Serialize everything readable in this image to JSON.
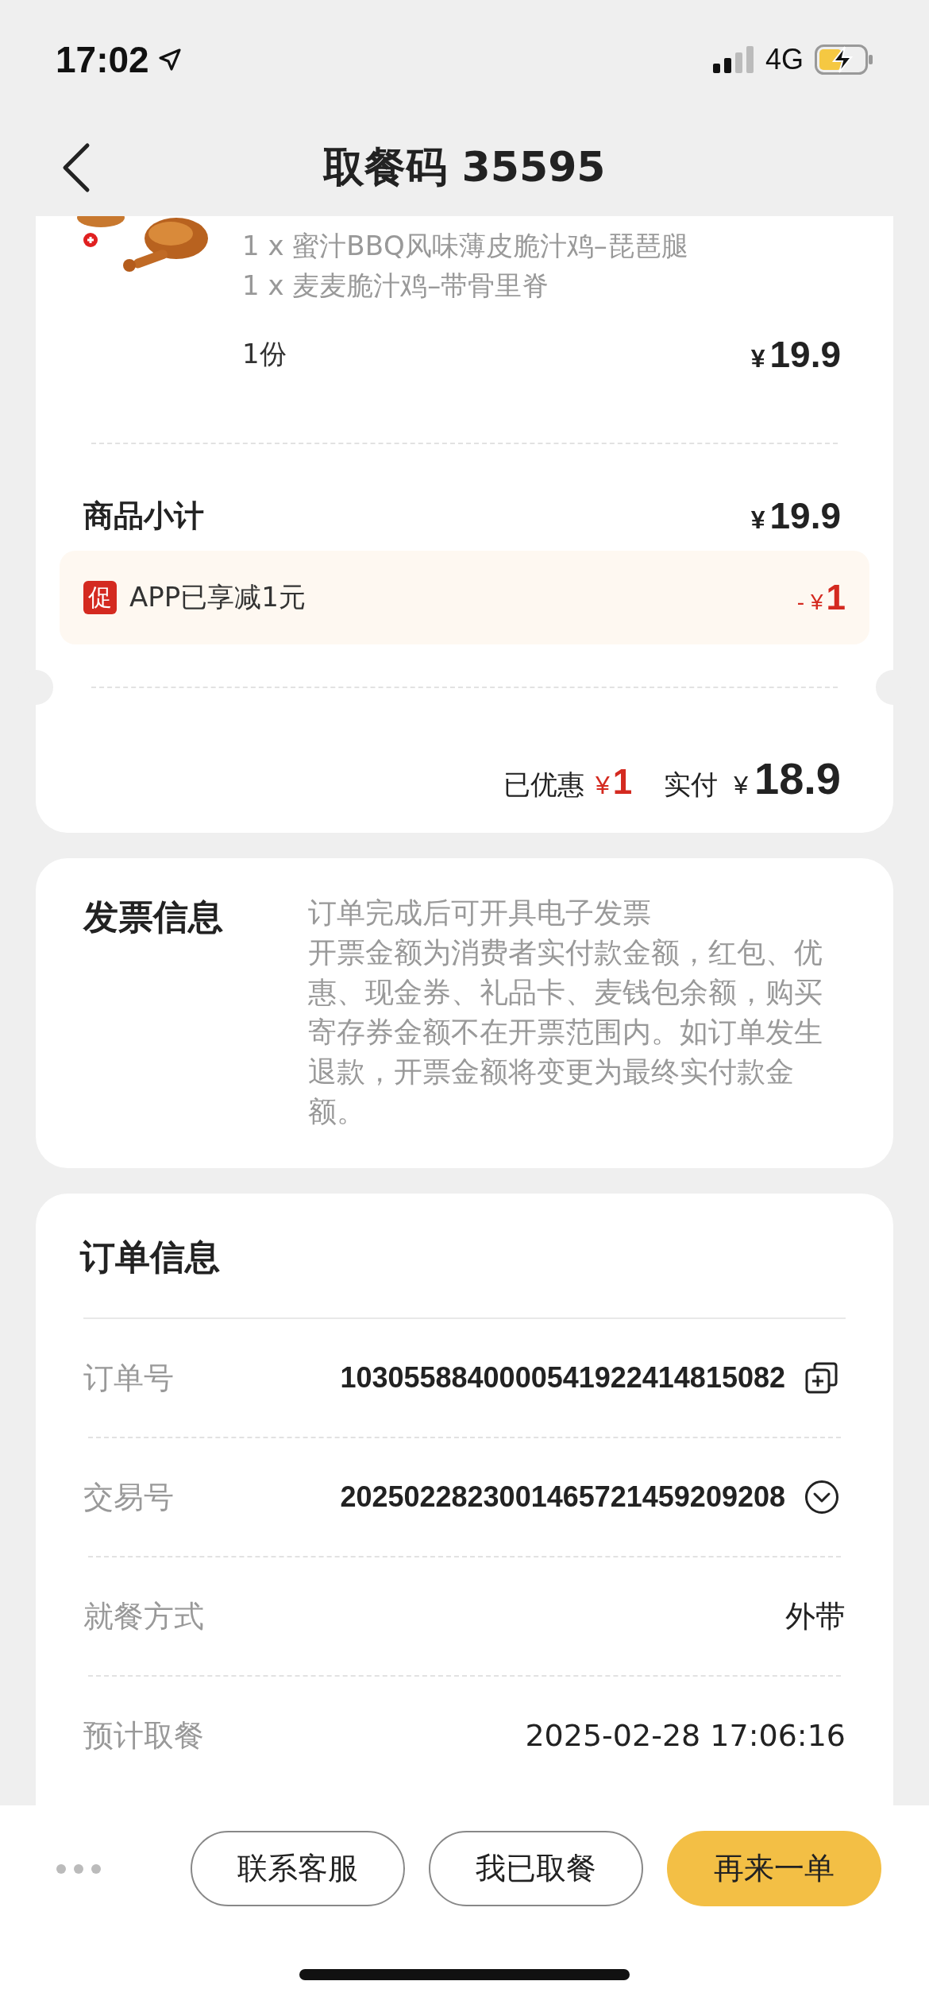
{
  "status_bar": {
    "time": "17:02",
    "network": "4G"
  },
  "nav": {
    "title": "取餐码 35595"
  },
  "order_items": {
    "lines": [
      "1 x 蜜汁BBQ风味薄皮脆汁鸡–琵琶腿",
      "1 x 麦麦脆汁鸡–带骨里脊"
    ],
    "quantity": "1份",
    "currency": "¥",
    "price": "19.9"
  },
  "subtotal": {
    "label": "商品小计",
    "currency": "¥",
    "amount": "19.9"
  },
  "promotion": {
    "badge": "促",
    "text": "APP已享减1元",
    "sign": "-",
    "currency": "¥",
    "amount": "1"
  },
  "total": {
    "discount_label": "已优惠",
    "discount_currency": "¥",
    "discount": "1",
    "paid_label": "实付",
    "paid_currency": "¥",
    "paid": "18.9"
  },
  "invoice": {
    "title": "发票信息",
    "lines": [
      "订单完成后可开具电子发票",
      "开票金额为消费者实付款金额，红包、优惠、现金券、礼品卡、麦钱包余额，购买寄存券金额不在开票范围内。如订单发生退款，开票金额将变更为最终实付款金额。"
    ]
  },
  "order_info": {
    "title": "订单信息",
    "rows": [
      {
        "label": "订单号",
        "value": "1030558840000541922414815082",
        "kind": "copy"
      },
      {
        "label": "交易号",
        "value": "2025022823001465721459209208",
        "kind": "expand"
      },
      {
        "label": "就餐方式",
        "value": "外带",
        "kind": "plain"
      },
      {
        "label": "预计取餐",
        "value": "2025-02-28 17:06:16",
        "kind": "plain"
      }
    ]
  },
  "actions": [
    {
      "label": "联系客服",
      "kind": "outline"
    },
    {
      "label": "我已取餐",
      "kind": "outline"
    },
    {
      "label": "再来一单",
      "kind": "primary"
    }
  ]
}
